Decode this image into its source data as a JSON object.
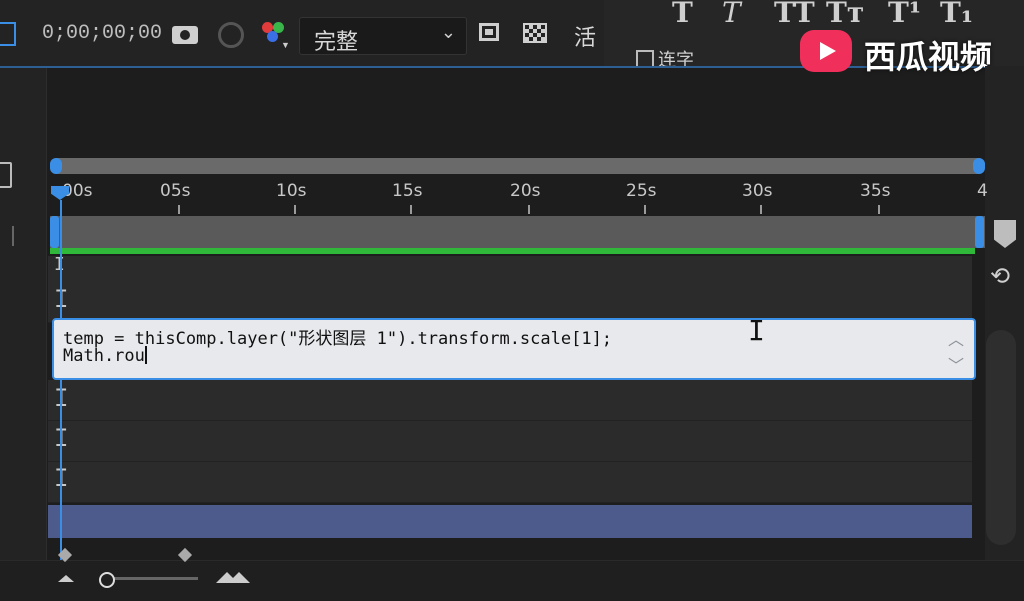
{
  "toolbar": {
    "timecode": "0;00;00;00",
    "resolution": "完整",
    "partial_label": "活"
  },
  "char_panel": {
    "buttons": [
      "T",
      "T",
      "TT",
      "Tт",
      "T¹",
      "T₁"
    ],
    "partial_label": "连字"
  },
  "watermark": {
    "text": "西瓜视频"
  },
  "ruler": {
    "labels": [
      "00s",
      "05s",
      "10s",
      "15s",
      "20s",
      "25s",
      "30s",
      "35s",
      "4"
    ]
  },
  "expression": {
    "line1": "temp = thisComp.layer(\"形状图层 1\").transform.scale[1];",
    "line2": "Math.rou"
  },
  "colors": {
    "accent": "#3a8ee6",
    "workarea_green": "#2fb83a",
    "selected_layer": "#4d5a8c",
    "watermark_logo": "#f0305a"
  },
  "icons": {
    "left_top": "window-icon",
    "camera": "camera-icon",
    "channels": "color-channels-icon",
    "region": "region-of-interest-icon",
    "transparency": "transparency-grid-icon",
    "cursor": "text-cursor-icon"
  }
}
